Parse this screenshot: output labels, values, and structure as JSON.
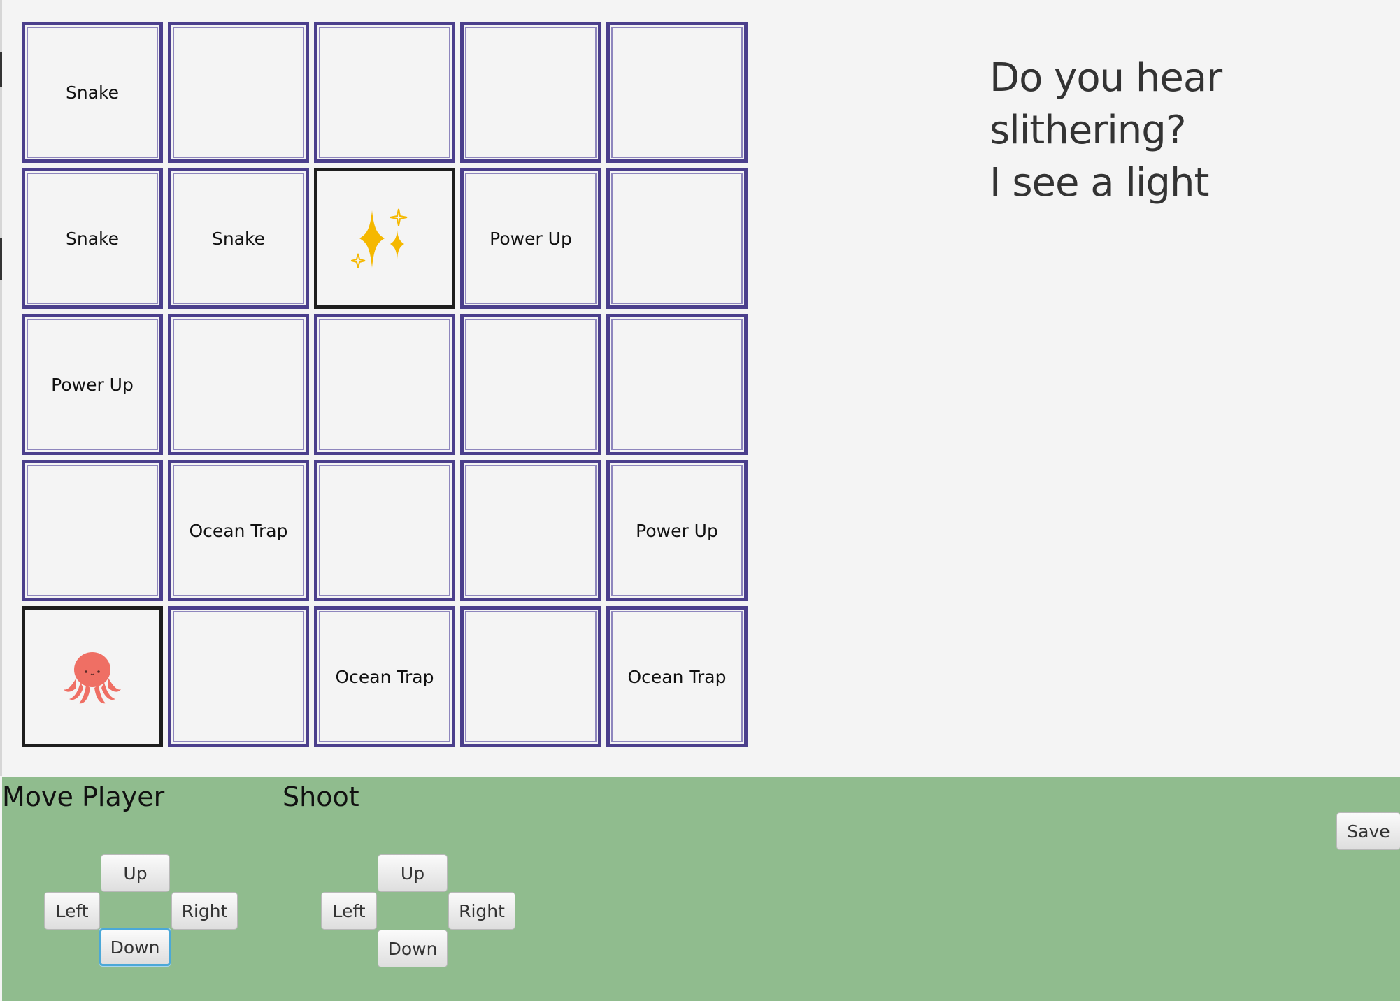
{
  "board": {
    "cells": [
      [
        "Snake",
        "",
        "",
        "",
        ""
      ],
      [
        "Snake",
        "Snake",
        "",
        "Power Up",
        ""
      ],
      [
        "Power Up",
        "",
        "",
        "",
        ""
      ],
      [
        "",
        "Ocean Trap",
        "",
        "",
        "Power Up"
      ],
      [
        "",
        "",
        "Ocean Trap",
        "",
        "Ocean Trap"
      ]
    ],
    "player_position": {
      "row": 5,
      "col": 1
    },
    "player_icon": "octopus-icon",
    "sparkle_position": {
      "row": 2,
      "col": 3
    },
    "sparkle_icon": "sparkles-icon"
  },
  "messages": [
    "Do you hear slithering?",
    "I see a light"
  ],
  "move": {
    "title": "Move Player",
    "up": "Up",
    "left": "Left",
    "right": "Right",
    "down": "Down"
  },
  "shoot": {
    "title": "Shoot",
    "up": "Up",
    "left": "Left",
    "right": "Right",
    "down": "Down"
  },
  "save_label": "Save",
  "colors": {
    "grid_border": "#4b3f8c",
    "panel_bg": "#90bc8e",
    "page_bg": "#f4f4f4",
    "sparkle": "#f5b800",
    "octopus": "#ef6f64"
  }
}
